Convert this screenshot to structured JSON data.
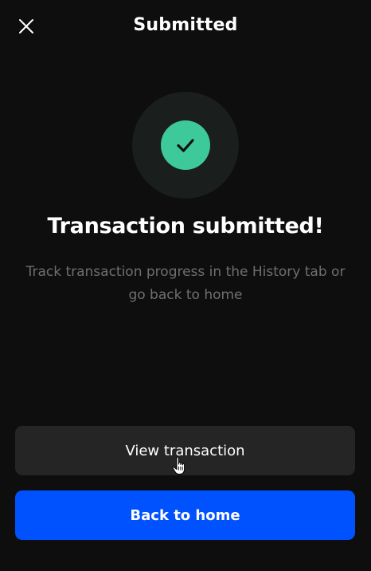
{
  "header": {
    "title": "Submitted",
    "close_icon": "close-icon"
  },
  "status": {
    "icon": "checkmark-icon",
    "icon_color": "#3ec99b",
    "headline": "Transaction submitted!",
    "subtext": "Track transaction progress in the History tab or go back to home"
  },
  "actions": {
    "view_transaction_label": "View transaction",
    "back_home_label": "Back to home",
    "primary_color": "#0052ff"
  },
  "cursor": {
    "icon": "hand-pointer-icon"
  }
}
